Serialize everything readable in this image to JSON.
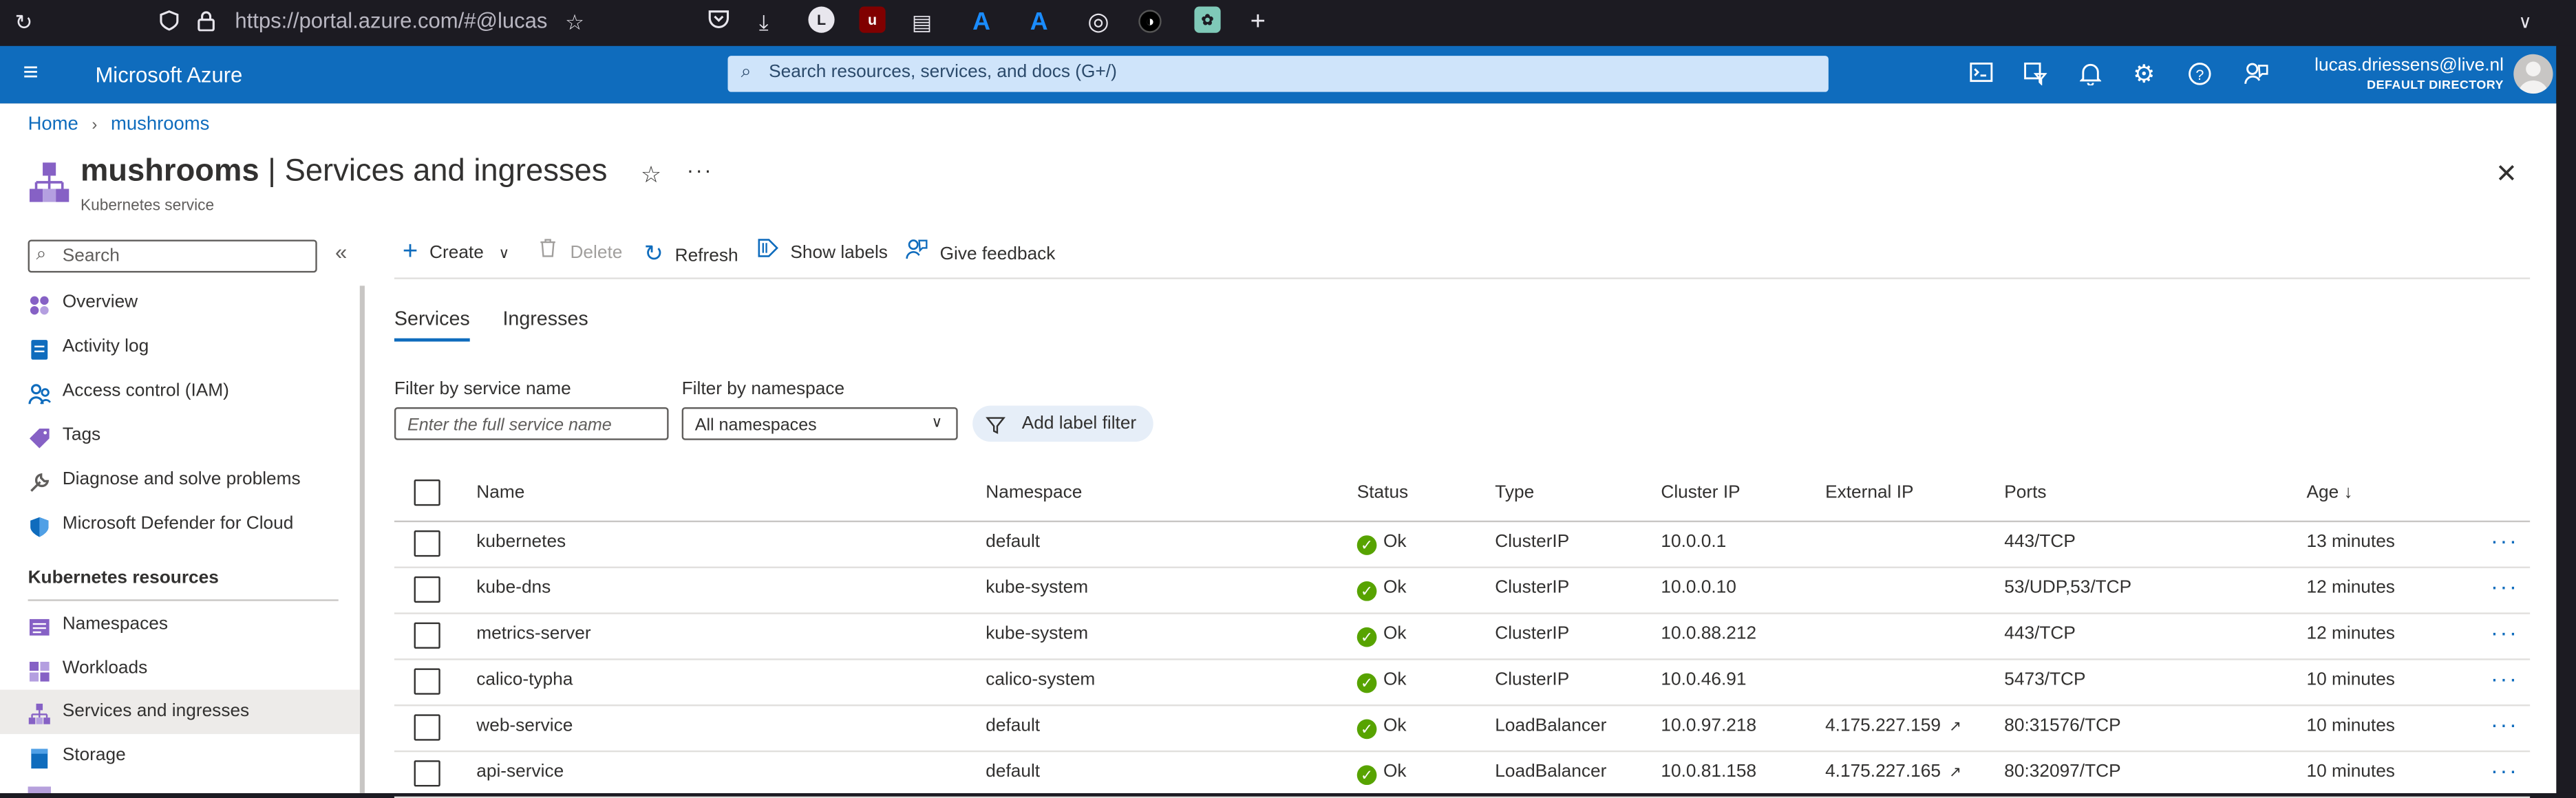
{
  "browser": {
    "url": "https://portal.azure.com/#@lucas",
    "avatar_letter": "L"
  },
  "topbar": {
    "brand": "Microsoft Azure",
    "search_placeholder": "Search resources, services, and docs (G+/)",
    "user_email": "lucas.driessens@live.nl",
    "user_directory": "DEFAULT DIRECTORY"
  },
  "breadcrumb": {
    "home": "Home",
    "current": "mushrooms"
  },
  "header": {
    "resource_name": "mushrooms",
    "separator": " | ",
    "page_title": "Services and ingresses",
    "subtitle": "Kubernetes service"
  },
  "sidebar": {
    "search_placeholder": "Search",
    "items": [
      {
        "label": "Overview",
        "icon": "overview-icon"
      },
      {
        "label": "Activity log",
        "icon": "activity-log-icon"
      },
      {
        "label": "Access control (IAM)",
        "icon": "iam-icon"
      },
      {
        "label": "Tags",
        "icon": "tag-icon"
      },
      {
        "label": "Diagnose and solve problems",
        "icon": "wrench-icon"
      },
      {
        "label": "Microsoft Defender for Cloud",
        "icon": "shield-icon"
      }
    ],
    "section_title": "Kubernetes resources",
    "section_items": [
      {
        "label": "Namespaces",
        "icon": "namespaces-icon"
      },
      {
        "label": "Workloads",
        "icon": "workloads-icon"
      },
      {
        "label": "Services and ingresses",
        "icon": "services-icon",
        "selected": true
      },
      {
        "label": "Storage",
        "icon": "storage-icon"
      }
    ]
  },
  "toolbar": {
    "create": "Create",
    "delete": "Delete",
    "refresh": "Refresh",
    "show_labels": "Show labels",
    "give_feedback": "Give feedback"
  },
  "tabs": [
    {
      "label": "Services",
      "active": true
    },
    {
      "label": "Ingresses",
      "active": false
    }
  ],
  "filters": {
    "service_label": "Filter by service name",
    "service_placeholder": "Enter the full service name",
    "namespace_label": "Filter by namespace",
    "namespace_value": "All namespaces",
    "add_label_filter": "Add label filter"
  },
  "table": {
    "columns": [
      "Name",
      "Namespace",
      "Status",
      "Type",
      "Cluster IP",
      "External IP",
      "Ports",
      "Age ↓"
    ],
    "rows": [
      {
        "name": "kubernetes",
        "namespace": "default",
        "status": "Ok",
        "type": "ClusterIP",
        "cluster_ip": "10.0.0.1",
        "external_ip": "",
        "ports": "443/TCP",
        "age": "13 minutes"
      },
      {
        "name": "kube-dns",
        "namespace": "kube-system",
        "status": "Ok",
        "type": "ClusterIP",
        "cluster_ip": "10.0.0.10",
        "external_ip": "",
        "ports": "53/UDP,53/TCP",
        "age": "12 minutes"
      },
      {
        "name": "metrics-server",
        "namespace": "kube-system",
        "status": "Ok",
        "type": "ClusterIP",
        "cluster_ip": "10.0.88.212",
        "external_ip": "",
        "ports": "443/TCP",
        "age": "12 minutes"
      },
      {
        "name": "calico-typha",
        "namespace": "calico-system",
        "status": "Ok",
        "type": "ClusterIP",
        "cluster_ip": "10.0.46.91",
        "external_ip": "",
        "ports": "5473/TCP",
        "age": "10 minutes"
      },
      {
        "name": "web-service",
        "namespace": "default",
        "status": "Ok",
        "type": "LoadBalancer",
        "cluster_ip": "10.0.97.218",
        "external_ip": "4.175.227.159",
        "ports": "80:31576/TCP",
        "age": "10 minutes"
      },
      {
        "name": "api-service",
        "namespace": "default",
        "status": "Ok",
        "type": "LoadBalancer",
        "cluster_ip": "10.0.81.158",
        "external_ip": "4.175.227.165",
        "ports": "80:32097/TCP",
        "age": "10 minutes"
      }
    ]
  },
  "colors": {
    "azure_blue": "#0f6cbd",
    "ok_green": "#57a300",
    "browser_dark": "#1c1b22"
  }
}
